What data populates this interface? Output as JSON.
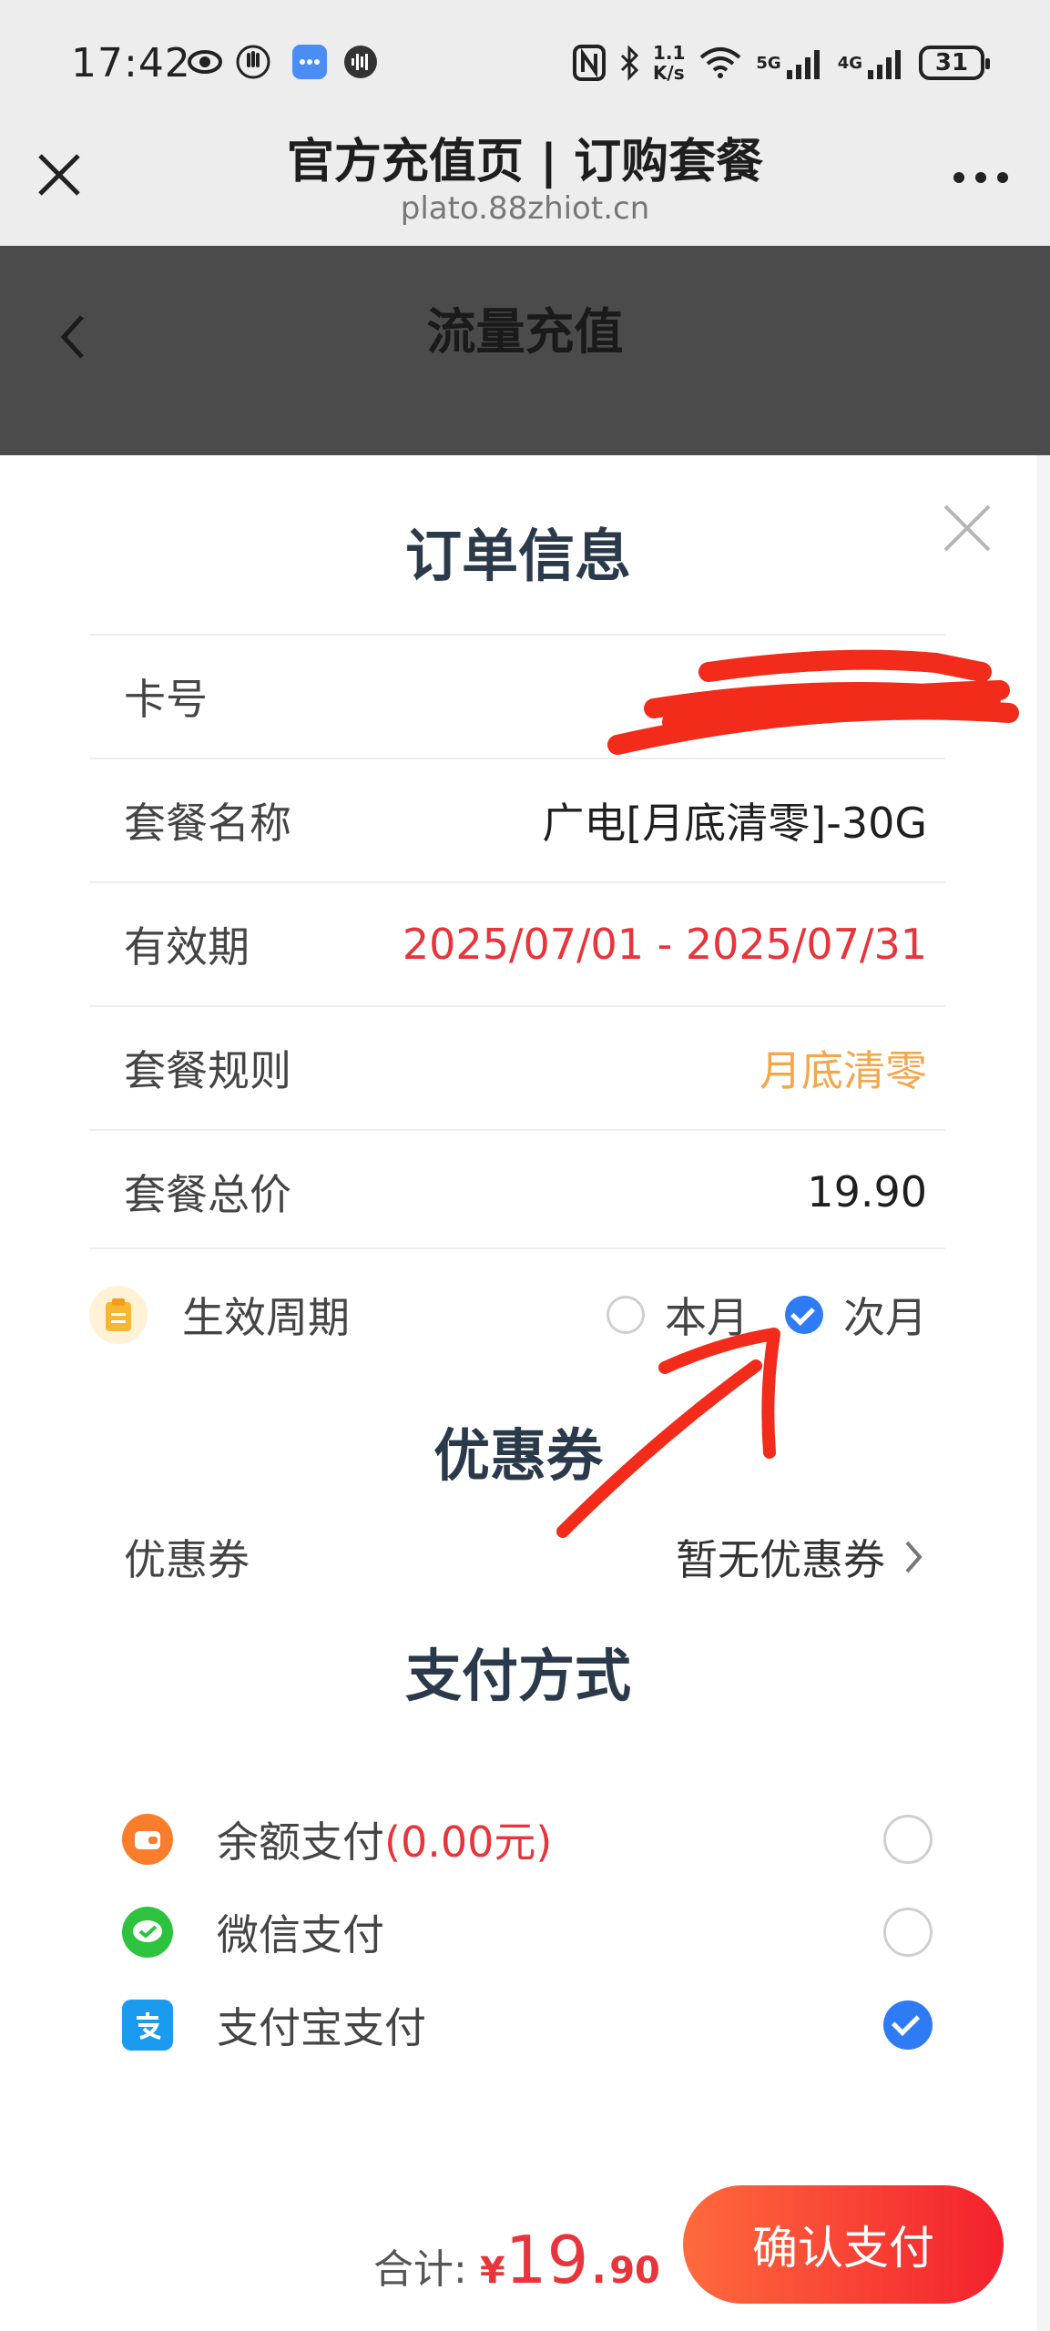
{
  "status_bar": {
    "time": "17:42",
    "speed_top": "1.1",
    "speed_unit": "K/s",
    "net1": "5G",
    "net2": "4G",
    "battery": "31"
  },
  "browser": {
    "title": "官方充值页 | 订购套餐",
    "url": "plato.88zhiot.cn",
    "close_icon": "close-icon",
    "more_icon": "more-icon"
  },
  "page": {
    "title": "流量充值"
  },
  "order": {
    "title": "订单信息",
    "rows": [
      {
        "label": "卡号",
        "value": ""
      },
      {
        "label": "套餐名称",
        "value": "广电[月底清零]-30G"
      },
      {
        "label": "有效期",
        "value": "2025/07/01 - 2025/07/31"
      },
      {
        "label": "套餐规则",
        "value": "月底清零"
      },
      {
        "label": "套餐总价",
        "value": "19.90"
      }
    ],
    "period": {
      "label": "生效周期",
      "option_current": "本月",
      "option_next": "次月",
      "selected": "次月"
    }
  },
  "coupon": {
    "title": "优惠券",
    "label": "优惠券",
    "value": "暂无优惠券"
  },
  "payment": {
    "title": "支付方式",
    "methods": [
      {
        "label": "余额支付",
        "extra": "(0.00元)",
        "selected": false
      },
      {
        "label": "微信支付",
        "extra": "",
        "selected": false
      },
      {
        "label": "支付宝支付",
        "extra": "",
        "selected": true
      }
    ]
  },
  "footer": {
    "total_label": "合计:",
    "currency": "¥",
    "total_int": "19.",
    "total_dec": "90",
    "confirm_label": "确认支付"
  },
  "colors": {
    "accent_blue": "#2f7bf5",
    "price_red": "#e8343a",
    "rule_orange": "#f4a64a"
  }
}
